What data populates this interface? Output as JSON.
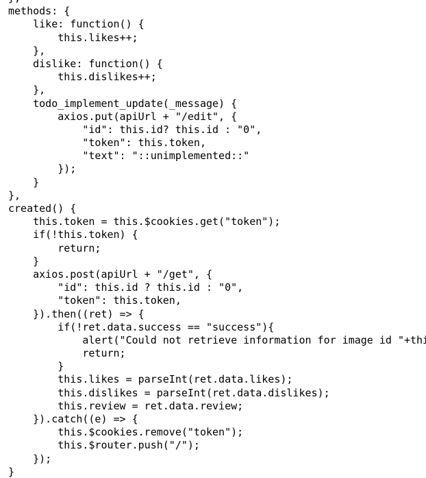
{
  "document": {
    "kind": "source-code-listing",
    "language": "javascript",
    "background_color": "#ffffff",
    "text_color": "#000000",
    "font_size_px": 15,
    "line_height_px": 19.2,
    "first_line_clipped_top": true,
    "lines": [
      "},",
      "methods: {",
      "    like: function() {",
      "        this.likes++;",
      "    },",
      "    dislike: function() {",
      "        this.dislikes++;",
      "    },",
      "    todo_implement_update(_message) {",
      "        axios.put(apiUrl + \"/edit\", {",
      "            \"id\": this.id? this.id : \"0\",",
      "            \"token\": this.token,",
      "            \"text\": \"::unimplemented::\"",
      "        });",
      "    }",
      "},",
      "created() {",
      "    this.token = this.$cookies.get(\"token\");",
      "    if(!this.token) {",
      "        return;",
      "    }",
      "    axios.post(apiUrl + \"/get\", {",
      "        \"id\": this.id ? this.id : \"0\",",
      "        \"token\": this.token,",
      "    }).then((ret) => {",
      "        if(!ret.data.success == \"success\"){",
      "            alert(\"Could not retrieve information for image id \"+this.id);",
      "            return;",
      "        }",
      "        this.likes = parseInt(ret.data.likes);",
      "        this.dislikes = parseInt(ret.data.dislikes);",
      "        this.review = ret.data.review;",
      "    }).catch((e) => {",
      "        this.$cookies.remove(\"token\");",
      "        this.$router.push(\"/\");",
      "    });",
      "}"
    ]
  }
}
